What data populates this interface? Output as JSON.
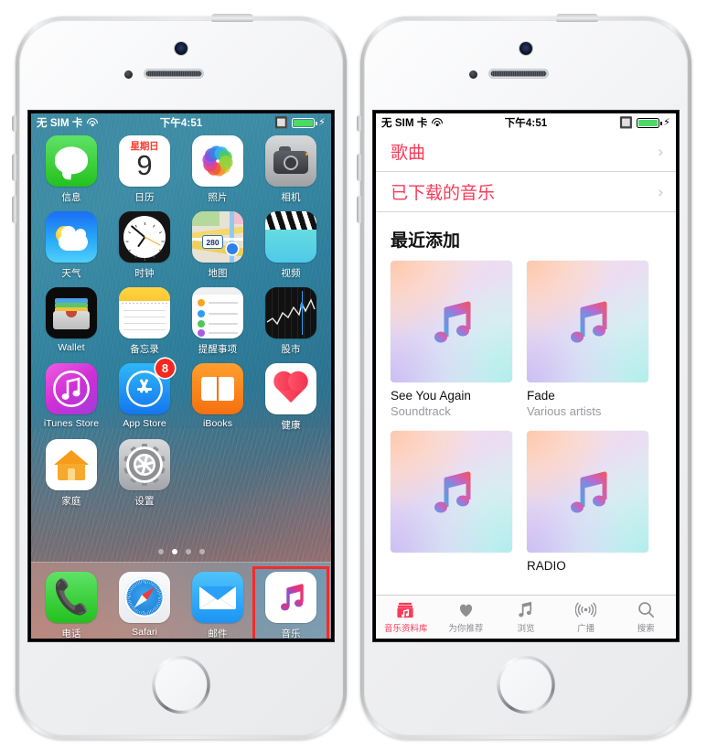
{
  "left_phone": {
    "status_bar": {
      "carrier": "无 SIM 卡",
      "wifi_icon": "wifi-icon",
      "time": "下午4:51",
      "bluetooth_icon": "bluetooth-icon",
      "battery_icon": "battery-icon",
      "charging_icon": "lightning-bolt-icon"
    },
    "home_screen": {
      "rows": [
        [
          {
            "label": "信息",
            "icon": "messages-icon"
          },
          {
            "label": "日历",
            "icon": "calendar-icon",
            "weekday": "星期日",
            "day": "9"
          },
          {
            "label": "照片",
            "icon": "photos-icon"
          },
          {
            "label": "相机",
            "icon": "camera-icon"
          }
        ],
        [
          {
            "label": "天气",
            "icon": "weather-icon"
          },
          {
            "label": "时钟",
            "icon": "clock-icon"
          },
          {
            "label": "地图",
            "icon": "maps-icon",
            "shield": "280"
          },
          {
            "label": "视频",
            "icon": "videos-icon"
          }
        ],
        [
          {
            "label": "Wallet",
            "icon": "wallet-icon"
          },
          {
            "label": "备忘录",
            "icon": "notes-icon"
          },
          {
            "label": "提醒事项",
            "icon": "reminders-icon"
          },
          {
            "label": "股市",
            "icon": "stocks-icon"
          }
        ],
        [
          {
            "label": "iTunes Store",
            "icon": "itunes-store-icon"
          },
          {
            "label": "App Store",
            "icon": "app-store-icon",
            "badge": "8"
          },
          {
            "label": "iBooks",
            "icon": "ibooks-icon"
          },
          {
            "label": "健康",
            "icon": "health-icon"
          }
        ],
        [
          {
            "label": "家庭",
            "icon": "home-app-icon"
          },
          {
            "label": "设置",
            "icon": "settings-icon"
          }
        ]
      ],
      "page_dots": {
        "count": 4,
        "active_index": 1
      },
      "dock": [
        {
          "label": "电话",
          "icon": "phone-icon"
        },
        {
          "label": "Safari",
          "icon": "safari-icon"
        },
        {
          "label": "邮件",
          "icon": "mail-icon"
        },
        {
          "label": "音乐",
          "icon": "music-icon",
          "highlighted": true
        }
      ]
    }
  },
  "right_phone": {
    "status_bar": {
      "carrier": "无 SIM 卡",
      "wifi_icon": "wifi-icon",
      "time": "下午4:51",
      "bluetooth_icon": "bluetooth-icon",
      "battery_icon": "battery-icon",
      "charging_icon": "lightning-bolt-icon"
    },
    "music_app": {
      "list_rows": [
        {
          "label": "歌曲"
        },
        {
          "label": "已下载的音乐"
        }
      ],
      "section_title": "最近添加",
      "albums": [
        {
          "title": "See You Again",
          "subtitle": "Soundtrack",
          "art": "music-note-artwork"
        },
        {
          "title": "Fade",
          "subtitle": "Various artists",
          "art": "music-note-artwork"
        },
        {
          "title": "",
          "subtitle": "",
          "art": "music-note-artwork"
        },
        {
          "title": "RADIO",
          "subtitle": "",
          "art": "music-note-artwork"
        }
      ],
      "tabs": [
        {
          "label": "音乐资料库",
          "icon": "library-icon",
          "active": true
        },
        {
          "label": "为你推荐",
          "icon": "heart-icon",
          "active": false
        },
        {
          "label": "浏览",
          "icon": "music-note-icon",
          "active": false
        },
        {
          "label": "广播",
          "icon": "radio-waves-icon",
          "active": false
        },
        {
          "label": "搜索",
          "icon": "search-icon",
          "active": false
        }
      ]
    }
  },
  "colors": {
    "accent_pink": "#fb3a58",
    "highlight_red": "#f42b2b",
    "badge_red": "#f5271f",
    "battery_green": "#4cd964",
    "tab_inactive_gray": "#8e8e93"
  }
}
